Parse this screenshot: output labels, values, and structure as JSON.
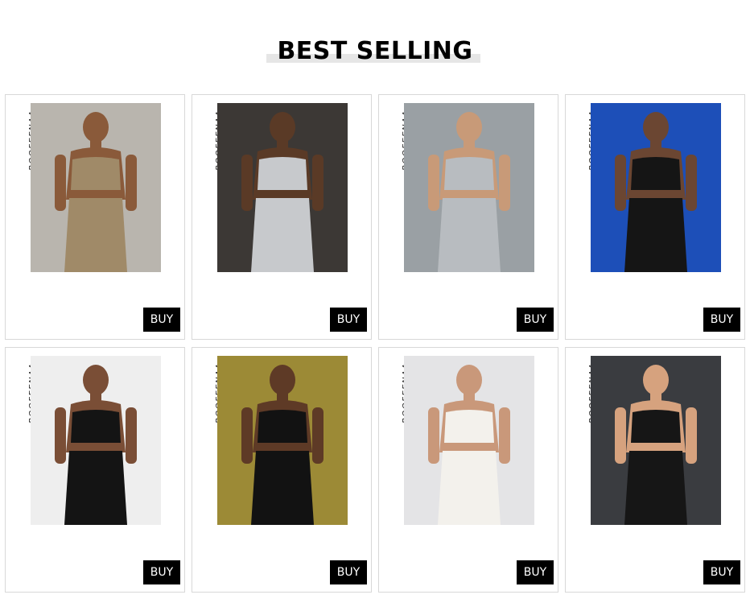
{
  "section": {
    "title": "BEST SELLING"
  },
  "products": [
    {
      "brand": "BOOFEENAA",
      "buy_label": "BUY",
      "image_icon": "model-photo-tan-cutout-dress",
      "colors": {
        "bg": "#b9b5ae",
        "outfit": "#a08a68",
        "skin": "#8a5a3a"
      }
    },
    {
      "brand": "BOOFEENAA",
      "buy_label": "BUY",
      "image_icon": "model-photo-grey-sweatpants",
      "colors": {
        "bg": "#3c3835",
        "outfit": "#c7c9cc",
        "skin": "#5a3a26"
      }
    },
    {
      "brand": "BOOFEENAA",
      "buy_label": "BUY",
      "image_icon": "model-photo-white-crop-joggers",
      "colors": {
        "bg": "#9aa0a4",
        "outfit": "#b8bcc0",
        "skin": "#c89a78"
      }
    },
    {
      "brand": "BOOFEENAA",
      "buy_label": "BUY",
      "image_icon": "model-photo-black-flare-set",
      "colors": {
        "bg": "#1d4fb8",
        "outfit": "#151515",
        "skin": "#6b4632"
      }
    },
    {
      "brand": "BOOFEENAA",
      "buy_label": "BUY",
      "image_icon": "model-photo-black-halter-top",
      "colors": {
        "bg": "#eeeeee",
        "outfit": "#141414",
        "skin": "#7a4e36"
      }
    },
    {
      "brand": "BOOFEENAA",
      "buy_label": "BUY",
      "image_icon": "model-photo-black-cutout-set",
      "colors": {
        "bg": "#9c8a36",
        "outfit": "#121212",
        "skin": "#5e3a26"
      }
    },
    {
      "brand": "BOOFEENAA",
      "buy_label": "BUY",
      "image_icon": "model-photo-white-lace-bustier",
      "colors": {
        "bg": "#e4e4e6",
        "outfit": "#f3f1ec",
        "skin": "#c9987a"
      }
    },
    {
      "brand": "BOOFEENAA",
      "buy_label": "BUY",
      "image_icon": "model-photo-black-butterfly-top",
      "colors": {
        "bg": "#3a3c40",
        "outfit": "#161616",
        "skin": "#d6a27e"
      }
    }
  ]
}
